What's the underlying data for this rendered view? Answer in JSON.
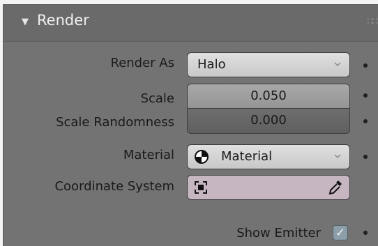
{
  "panel": {
    "title": "Render",
    "collapse_glyph": "▼",
    "drag_glyph": "∷∷"
  },
  "render_as": {
    "label": "Render As",
    "value": "Halo"
  },
  "scale": {
    "label": "Scale",
    "value": "0.050"
  },
  "scale_randomness": {
    "label": "Scale Randomness",
    "value": "0.000"
  },
  "material": {
    "label": "Material",
    "value": "Material"
  },
  "coordinate_system": {
    "label": "Coordinate System",
    "value": ""
  },
  "show_emitter": {
    "label": "Show Emitter",
    "checked": true,
    "check_glyph": "✓"
  },
  "colors": {
    "panel_bg": "#737373",
    "header_bg": "#6a6a6a",
    "coord_field": "#c6b6c2",
    "checkbox": "#8c9ea8"
  },
  "icons": {
    "material": "material-sphere-icon",
    "coordinate_system": "object-icon",
    "picker": "eyedropper-icon"
  }
}
